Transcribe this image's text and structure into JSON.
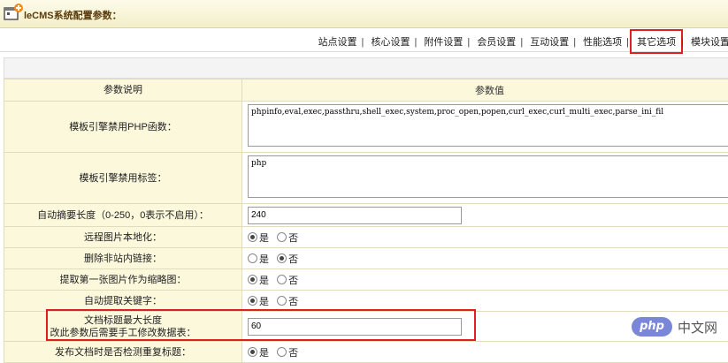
{
  "header": {
    "title": "leCMS系统配置参数：",
    "logo_icon": "add-window-icon"
  },
  "nav": {
    "items": [
      {
        "label": "站点设置"
      },
      {
        "label": "核心设置"
      },
      {
        "label": "附件设置"
      },
      {
        "label": "会员设置"
      },
      {
        "label": "互动设置"
      },
      {
        "label": "性能选项"
      },
      {
        "label": "其它选项"
      },
      {
        "label": "模块设置"
      }
    ],
    "active_index": 6
  },
  "table": {
    "col_desc": "参数说明",
    "col_value": "参数值",
    "rows": {
      "disabled_funcs": {
        "label": "模板引擎禁用PHP函数：",
        "value": "phpinfo,eval,exec,passthru,shell_exec,system,proc_open,popen,curl_exec,curl_multi_exec,parse_ini_fil"
      },
      "disabled_tags": {
        "label": "模板引擎禁用标签：",
        "value": "php"
      },
      "summary_len": {
        "label": "自动摘要长度（0-250，0表示不启用）：",
        "value": "240"
      },
      "remote_pic": {
        "label": "远程图片本地化：",
        "yes": "是",
        "no": "否",
        "selected": "yes"
      },
      "del_links": {
        "label": "删除非站内链接：",
        "yes": "是",
        "no": "否",
        "selected": "no"
      },
      "first_pic": {
        "label": "提取第一张图片作为缩略图：",
        "yes": "是",
        "no": "否",
        "selected": "yes"
      },
      "auto_keywords": {
        "label": "自动提取关键字：",
        "yes": "是",
        "no": "否",
        "selected": "yes"
      },
      "title_len": {
        "label1": "文档标题最大长度",
        "label2": "改此参数后需要手工修改数据表：",
        "value": "60"
      },
      "check_dup": {
        "label": "发布文档时是否检测重复标题：",
        "yes": "是",
        "no": "否",
        "selected": "yes"
      }
    }
  },
  "watermark": {
    "logo": "php",
    "text": "中文网"
  },
  "colors": {
    "highlight": "#e02020",
    "label_bg": "#fbf8dc"
  }
}
